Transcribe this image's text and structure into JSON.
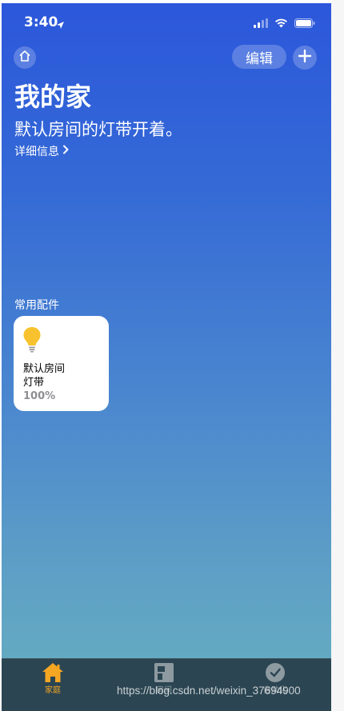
{
  "status_bar": {
    "time": "3:40"
  },
  "header": {
    "edit_label": "编辑"
  },
  "home": {
    "title": "我的家",
    "status_summary": "默认房间的灯带开着。",
    "details_link": "详细信息"
  },
  "favorites": {
    "section_label": "常用配件",
    "accessories": [
      {
        "room": "默认房间",
        "name": "灯带",
        "state": "100%",
        "icon": "lightbulb-icon"
      }
    ]
  },
  "tabbar": {
    "tabs": [
      {
        "label": "家庭",
        "icon": "house-icon",
        "active": true
      },
      {
        "label": "房间",
        "icon": "rooms-icon",
        "active": false
      },
      {
        "label": "自动化",
        "icon": "automation-icon",
        "active": false
      }
    ]
  },
  "watermark": "https://blog.csdn.net/weixin_37694900",
  "colors": {
    "accent_active": "#f5a623",
    "tab_inactive": "#8d9aa0",
    "tabbar_bg": "#2b4552",
    "bulb": "#f7c22d"
  }
}
